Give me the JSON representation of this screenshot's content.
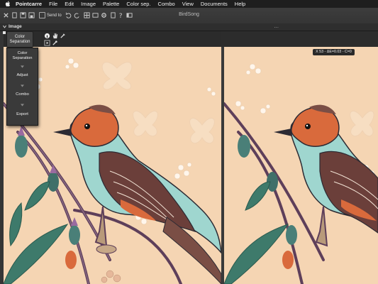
{
  "menubar": {
    "app_name": "Pointcarre",
    "items": [
      "File",
      "Edit",
      "Image",
      "Palette",
      "Color sep.",
      "Combo",
      "View",
      "Documents",
      "Help"
    ]
  },
  "window": {
    "title": "BirdSong",
    "send_to_label": "Send to"
  },
  "toolbar": {
    "image_menu_label": "Image",
    "dots": "..."
  },
  "floating_button": {
    "line1": "Color",
    "line2": "Separation"
  },
  "popup_menu": {
    "items": [
      {
        "line1": "Color",
        "line2": "Separation"
      },
      {
        "line1": "Adjust"
      },
      {
        "line1": "Combo"
      },
      {
        "line1": "Export"
      }
    ]
  },
  "readout": {
    "text": "X 53 - ΔE=0.03 - C=0"
  },
  "colors": {
    "background": "#f5d5b3",
    "bird_teal": "#9fd6cf",
    "bird_wing": "#6b3f3a",
    "bird_orange": "#d96a3c",
    "stem_purple": "#6b4a67",
    "leaf_green": "#3e7a6b"
  },
  "icons": {
    "apple": "apple-icon",
    "close": "close-icon",
    "save": "save-icon",
    "undo": "undo-icon",
    "redo": "redo-icon",
    "settings": "gear-icon",
    "help": "question-icon",
    "eyedropper": "eyedropper-icon",
    "info": "info-icon",
    "hand": "hand-icon"
  }
}
